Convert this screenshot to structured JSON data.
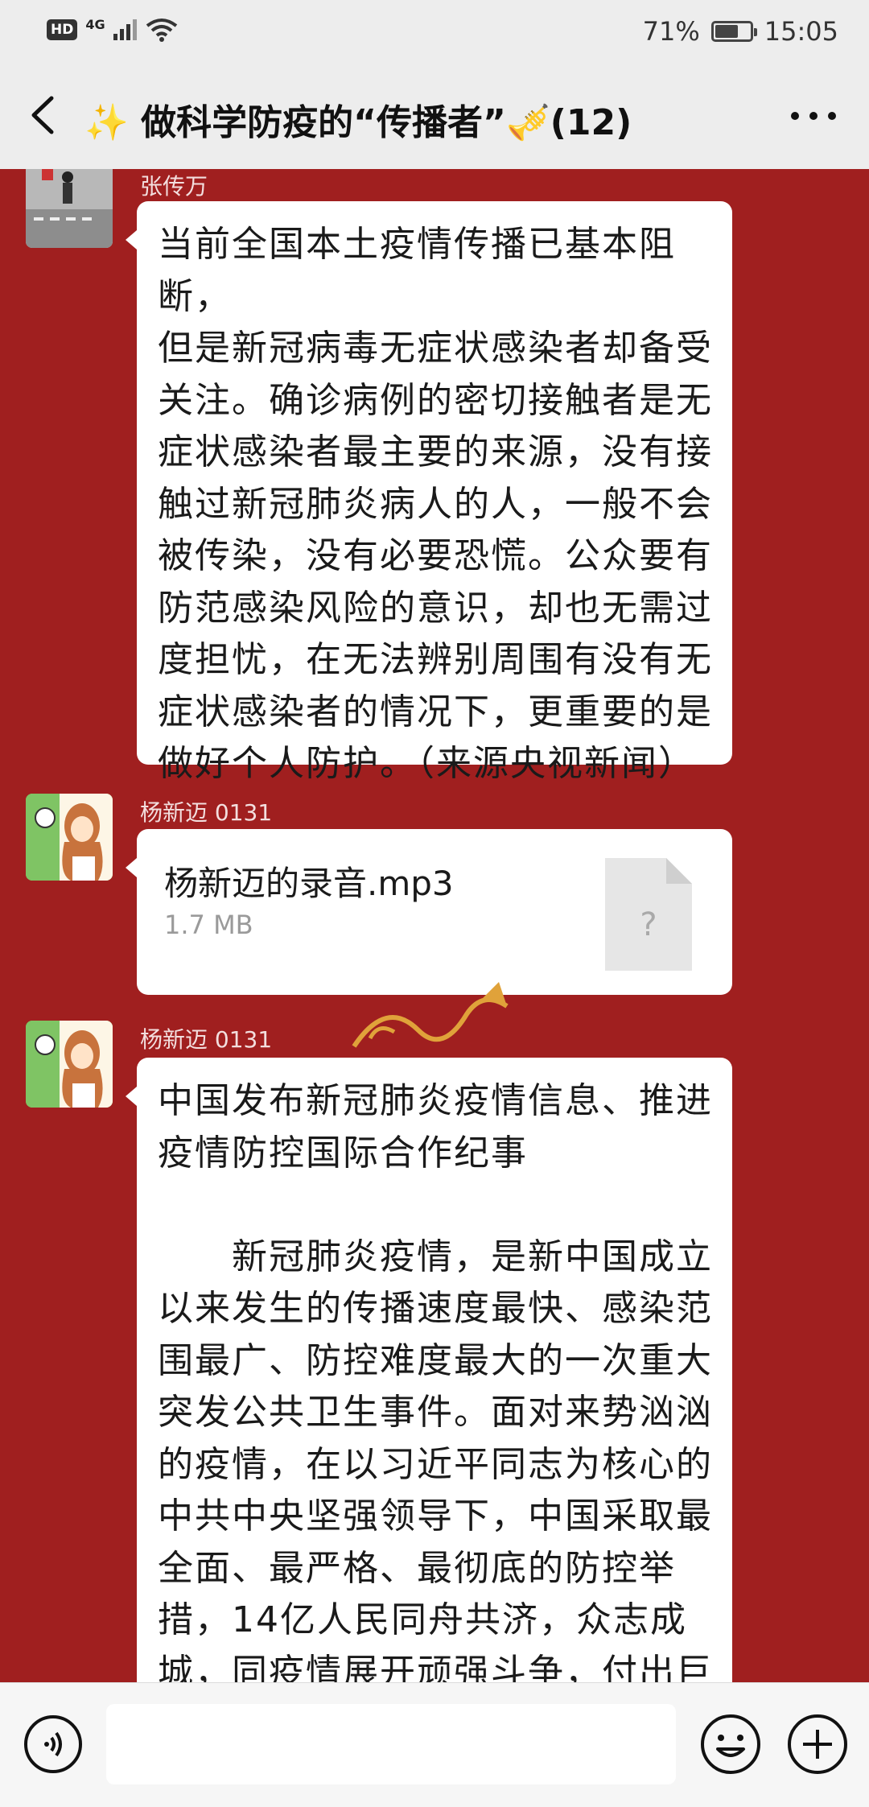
{
  "status_bar": {
    "hd": "HD",
    "network": "4G",
    "battery_percent": "71%",
    "battery_level": 0.71,
    "time": "15:05"
  },
  "header": {
    "title": "✨ 做科学防疫的“传播者”🎺(12)"
  },
  "messages": [
    {
      "sender": "张传万",
      "type": "text",
      "lines": [
        "当前全国本土疫情传播已基本阻断，",
        "但是新冠病毒无症状感染者却备受",
        "关注。确诊病例的密切接触者是无",
        "症状感染者最主要的来源，没有接",
        "触过新冠肺炎病人的人，一般不会",
        "被传染，没有必要恐慌。公众要有",
        "防范感染风险的意识，却也无需过",
        "度担忧，在无法辨别周围有没有无",
        "症状感染者的情况下，更重要的是",
        "做好个人防护。（来源央视新闻）"
      ]
    },
    {
      "sender": "杨新迈 0131",
      "type": "file",
      "file_name": "杨新迈的录音.mp3",
      "file_size": "1.7 MB",
      "file_icon_glyph": "?"
    },
    {
      "sender": "杨新迈 0131",
      "type": "text",
      "title_lines": [
        "中国发布新冠肺炎疫情信息、推进",
        "疫情防控国际合作纪事"
      ],
      "body_lines": [
        "　　新冠肺炎疫情，是新中国成立",
        "以来发生的传播速度最快、感染范",
        "围最广、防控难度最大的一次重大",
        "突发公共卫生事件。面对来势汹汹",
        "的疫情，在以习近平同志为核心的",
        "中共中央坚强领导下，中国采取最",
        "全面、最严格、最彻底的防控举",
        "措，14亿人民同舟共济，众志成",
        "城，同疫情展开顽强斗争，付出巨"
      ]
    }
  ],
  "input_bar": {
    "placeholder": ""
  }
}
